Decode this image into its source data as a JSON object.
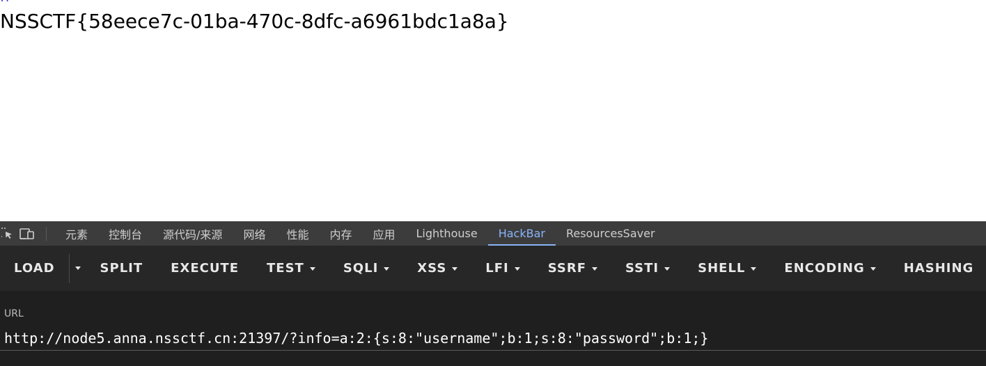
{
  "page": {
    "partial_prev_text": "!?",
    "flag_text": "NSSCTF{58eece7c-01ba-470c-8dfc-a6961bdc1a8a}"
  },
  "devtools": {
    "toolbar_icons": [
      "inspect-element-icon",
      "device-toolbar-icon"
    ],
    "tabs": [
      {
        "label": "元素",
        "active": false
      },
      {
        "label": "控制台",
        "active": false
      },
      {
        "label": "源代码/来源",
        "active": false
      },
      {
        "label": "网络",
        "active": false
      },
      {
        "label": "性能",
        "active": false
      },
      {
        "label": "内存",
        "active": false
      },
      {
        "label": "应用",
        "active": false
      },
      {
        "label": "Lighthouse",
        "active": false
      },
      {
        "label": "HackBar",
        "active": true
      },
      {
        "label": "ResourcesSaver",
        "active": false
      }
    ],
    "accent_color": "#8ab4f8"
  },
  "hackbar": {
    "load_label": "LOAD",
    "split_label": "SPLIT",
    "execute_label": "EXECUTE",
    "test_label": "TEST",
    "sqli_label": "SQLI",
    "xss_label": "XSS",
    "lfi_label": "LFI",
    "ssrf_label": "SSRF",
    "ssti_label": "SSTI",
    "shell_label": "SHELL",
    "encoding_label": "ENCODING",
    "hashing_label": "HASHING",
    "url_label": "URL",
    "url_value": "http://node5.anna.nssctf.cn:21397/?info=a:2:{s:8:\"username\";b:1;s:8:\"password\";b:1;}"
  }
}
